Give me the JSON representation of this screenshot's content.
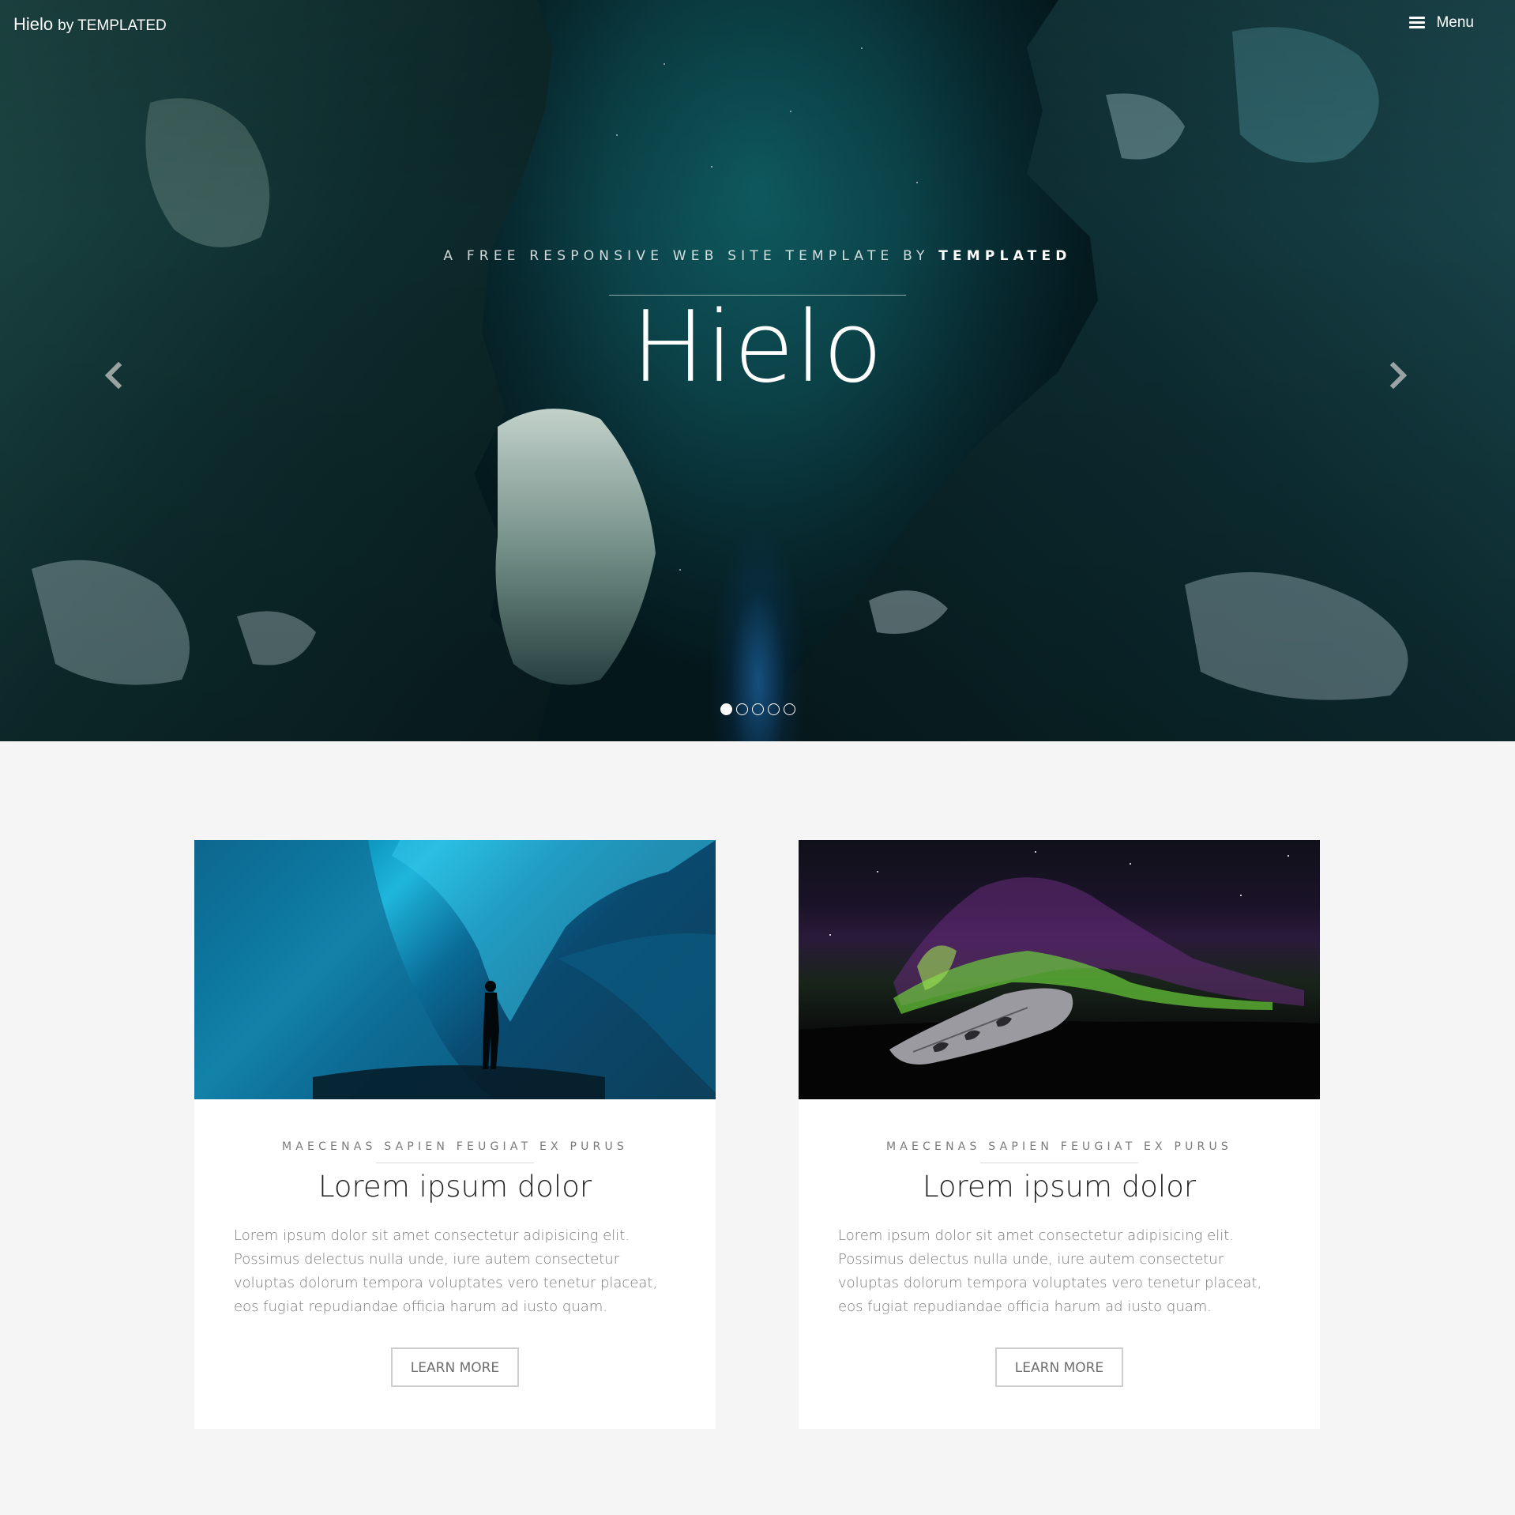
{
  "header": {
    "logo_name": "Hielo",
    "logo_by": "by TEMPLATED",
    "menu_label": "Menu",
    "menu_icon": "hamburger-icon"
  },
  "hero": {
    "subtitle_prefix": "A FREE RESPONSIVE WEB SITE TEMPLATE BY ",
    "subtitle_strong": "TEMPLATED",
    "title": "Hielo",
    "prev_icon": "chevron-left-icon",
    "next_icon": "chevron-right-icon",
    "slides_total": 5,
    "active_slide": 1
  },
  "cards": [
    {
      "image": "ice-cave-photo",
      "eyebrow": "MAECENAS SAPIEN FEUGIAT EX PURUS",
      "title": "Lorem ipsum dolor",
      "text": "Lorem ipsum dolor sit amet consectetur adipisicing elit. Possimus delectus nulla unde, iure autem consectetur voluptas dolorum tempora voluptates vero tenetur placeat, eos fugiat repudiandae officia harum ad iusto quam.",
      "button": "LEARN MORE"
    },
    {
      "image": "aurora-plane-photo",
      "eyebrow": "MAECENAS SAPIEN FEUGIAT EX PURUS",
      "title": "Lorem ipsum dolor",
      "text": "Lorem ipsum dolor sit amet consectetur adipisicing elit. Possimus delectus nulla unde, iure autem consectetur voluptas dolorum tempora voluptates vero tenetur placeat, eos fugiat repudiandae officia harum ad iusto quam.",
      "button": "LEARN MORE"
    }
  ],
  "colors": {
    "page_background": "#f5f5f5",
    "card_background": "#ffffff",
    "hero_teal": "#0b4349",
    "text_muted": "#7a7a7a",
    "title_dark": "#222222"
  }
}
